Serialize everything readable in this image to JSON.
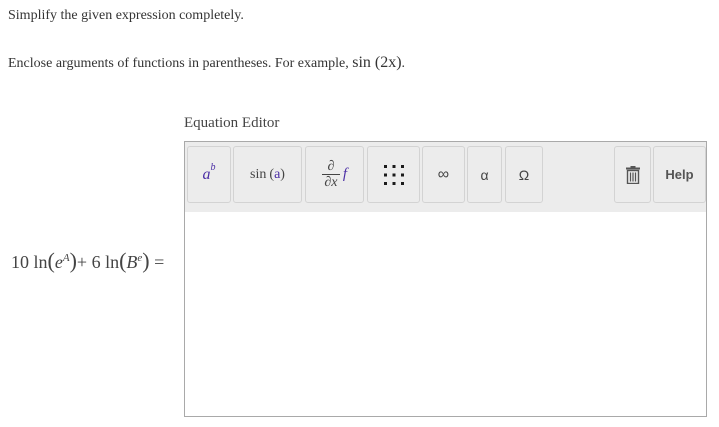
{
  "instructions": {
    "line1": "Simplify the given expression completely.",
    "line2_prefix": "Enclose arguments of functions in parentheses. For example, ",
    "line2_example": "sin (2x)",
    "line2_suffix": "."
  },
  "equation_editor": {
    "label": "Equation Editor",
    "toolbar": {
      "superscript": {
        "base": "a",
        "exp": "b"
      },
      "function": {
        "name": "sin",
        "arg": "a"
      },
      "derivative": {
        "top": "∂",
        "bottom": "∂x",
        "fn": "f"
      },
      "infinity": "∞",
      "alpha": "α",
      "omega": "Ω",
      "help": "Help"
    },
    "value": ""
  },
  "expression": {
    "coef1": "10",
    "fn1": "ln",
    "base1": "e",
    "exp1": "A",
    "op": "+",
    "coef2": "6",
    "fn2": "ln",
    "base2": "B",
    "exp2": "e",
    "eq": "="
  },
  "colors": {
    "toolbar_bg": "#ececec",
    "math_accent": "#4b2ea5",
    "border": "#a9a9a9",
    "text": "#333333"
  }
}
